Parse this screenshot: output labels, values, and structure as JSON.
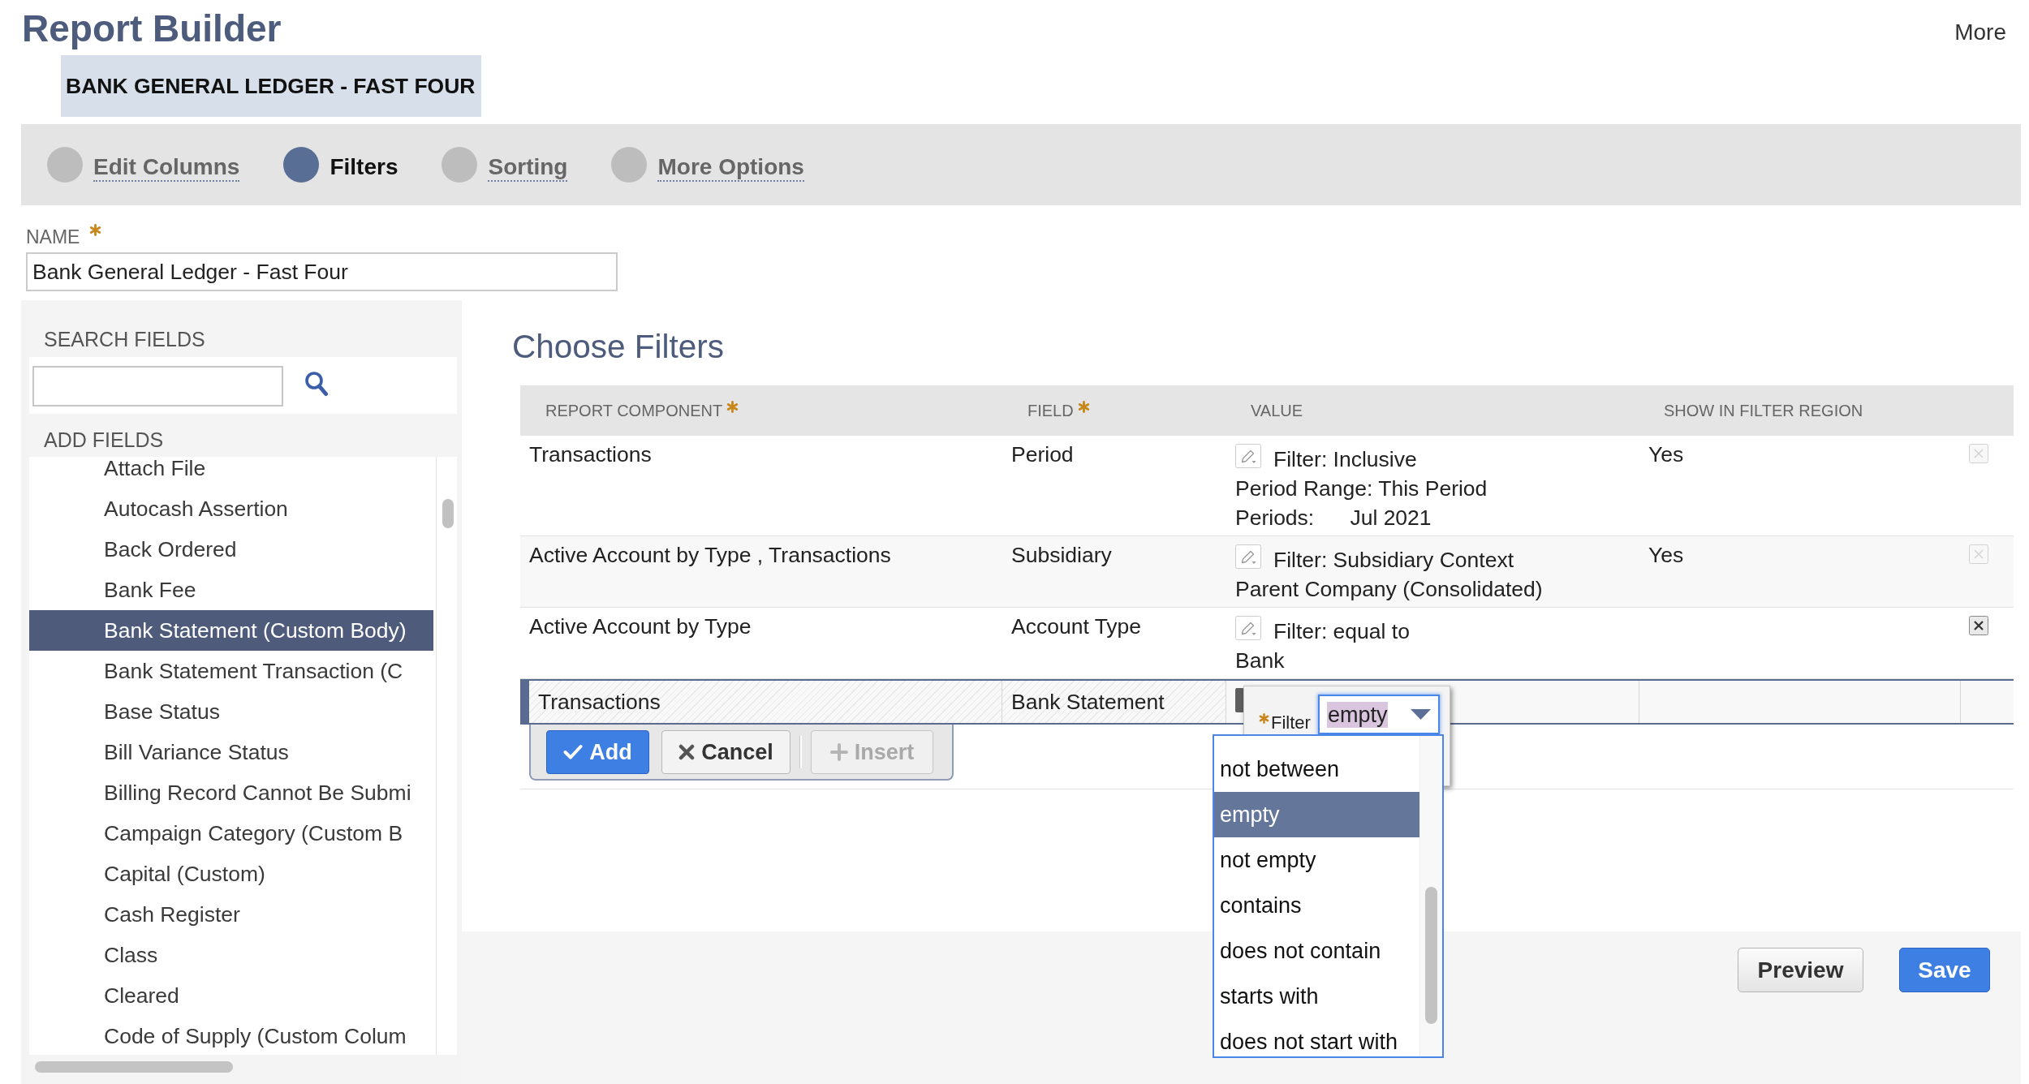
{
  "header": {
    "title": "Report Builder",
    "more_link": "More"
  },
  "record_name": "BANK GENERAL LEDGER - FAST FOUR",
  "steps": [
    {
      "label": "Edit Columns",
      "selected": false
    },
    {
      "label": "Filters",
      "selected": true
    },
    {
      "label": "Sorting",
      "selected": false
    },
    {
      "label": "More Options",
      "selected": false
    }
  ],
  "name_field": {
    "label": "NAME",
    "required": true,
    "value": "Bank General Ledger - Fast Four"
  },
  "field_picker": {
    "search_label": "SEARCH FIELDS",
    "add_label": "ADD FIELDS",
    "items": [
      {
        "label": "Attach File",
        "selected": false
      },
      {
        "label": "Autocash Assertion",
        "selected": false
      },
      {
        "label": "Back Ordered",
        "selected": false
      },
      {
        "label": "Bank Fee",
        "selected": false
      },
      {
        "label": "Bank Statement (Custom Body)",
        "selected": true
      },
      {
        "label": "Bank Statement Transaction (C",
        "selected": false
      },
      {
        "label": "Base Status",
        "selected": false
      },
      {
        "label": "Bill Variance Status",
        "selected": false
      },
      {
        "label": "Billing Record Cannot Be Submi",
        "selected": false
      },
      {
        "label": "Campaign Category (Custom B",
        "selected": false
      },
      {
        "label": "Capital (Custom)",
        "selected": false
      },
      {
        "label": "Cash Register",
        "selected": false
      },
      {
        "label": "Class",
        "selected": false
      },
      {
        "label": "Cleared",
        "selected": false
      },
      {
        "label": "Code of Supply (Custom Colum",
        "selected": false
      }
    ]
  },
  "filters": {
    "title": "Choose Filters",
    "columns": [
      {
        "label": "REPORT COMPONENT",
        "required": true
      },
      {
        "label": "FIELD",
        "required": true
      },
      {
        "label": "VALUE",
        "required": false
      },
      {
        "label": "SHOW IN FILTER REGION",
        "required": false
      }
    ],
    "rows": [
      {
        "component": "Transactions",
        "field": "Period",
        "value_lines": [
          "Filter: Inclusive",
          "Period Range: This Period",
          "Periods:      Jul 2021"
        ],
        "show_in_filter_region": "Yes",
        "remove_disabled": true,
        "editing": false
      },
      {
        "component": "Active Account by Type , Transactions",
        "field": "Subsidiary",
        "value_lines": [
          "Filter: Subsidiary Context",
          "Parent Company (Consolidated)"
        ],
        "show_in_filter_region": "Yes",
        "remove_disabled": true,
        "editing": false
      },
      {
        "component": "Active Account by Type",
        "field": "Account Type",
        "value_lines": [
          "Filter: equal to",
          "Bank"
        ],
        "remove_disabled": false,
        "editing": false
      },
      {
        "component": "Transactions",
        "field": "Bank Statement",
        "editing": true
      }
    ],
    "editor": {
      "label": "Filter",
      "required": true,
      "value": "empty",
      "value_highlighted": true,
      "options": [
        {
          "label": "not between",
          "selected": false
        },
        {
          "label": "empty",
          "selected": true
        },
        {
          "label": "not empty",
          "selected": false
        },
        {
          "label": "contains",
          "selected": false
        },
        {
          "label": "does not contain",
          "selected": false
        },
        {
          "label": "starts with",
          "selected": false
        },
        {
          "label": "does not start with",
          "selected": false
        }
      ]
    },
    "row_actions": [
      {
        "label": "Add",
        "kind": "add",
        "disabled": false
      },
      {
        "label": "Cancel",
        "kind": "cancel",
        "disabled": false
      },
      {
        "label": "Insert",
        "kind": "insert",
        "disabled": true
      }
    ]
  },
  "footer": {
    "buttons": [
      {
        "label": "Preview",
        "kind": "preview"
      },
      {
        "label": "Save",
        "kind": "save"
      }
    ]
  }
}
